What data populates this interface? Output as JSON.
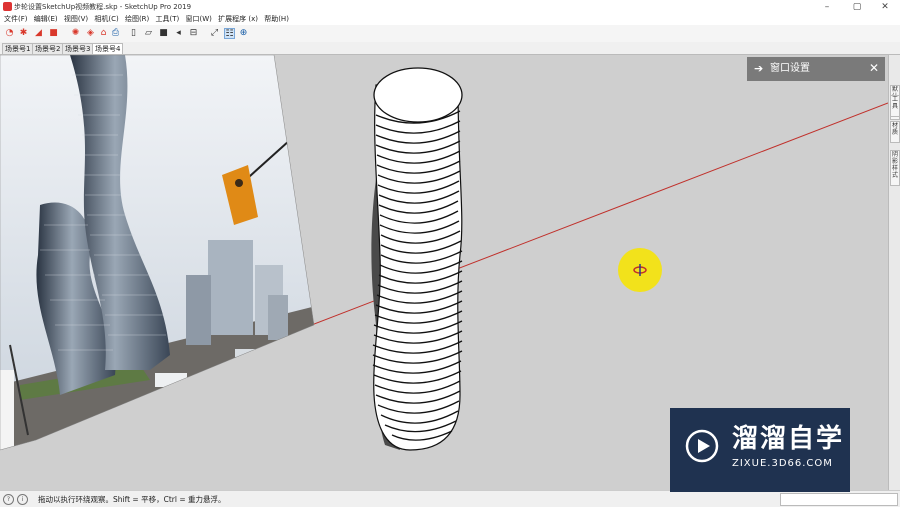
{
  "window": {
    "title": "步轮设置SketchUp视频教程.skp - SketchUp Pro 2019",
    "minimize_glyph": "–",
    "maximize_glyph": "▢",
    "close_glyph": "✕"
  },
  "menu": {
    "items": [
      "文件(F)",
      "编辑(E)",
      "视图(V)",
      "相机(C)",
      "绘图(R)",
      "工具(T)",
      "窗口(W)",
      "扩展程序 (x)",
      "帮助(H)"
    ]
  },
  "toolbar": {
    "icons": [
      "select-tool-icon",
      "paint-icon",
      "push-pull-icon",
      "camera-icon",
      "gear-icon",
      "component-icon",
      "warehouse-icon",
      "print-icon",
      "section-plane-icon",
      "section-icon",
      "section-fill-icon",
      "section-cut-icon",
      "scene-icon",
      "orbit-icon",
      "position-camera-icon",
      "look-around-icon"
    ]
  },
  "scenes": {
    "tabs": [
      "场景号1",
      "场景号2",
      "场景号3",
      "场景号4"
    ],
    "active_index": 3
  },
  "window_settings_panel": {
    "label": "窗口设置",
    "close_glyph": "✕"
  },
  "right_panel": {
    "tabs": [
      "默认面板",
      "工具",
      "材质",
      "阴影样式"
    ]
  },
  "statusbar": {
    "text": "拖动以执行环绕观察。Shift = 平移，Ctrl = 重力悬浮。"
  },
  "watermark": {
    "cn": "溜溜自学",
    "en": "ZIXUE.3D66.COM"
  },
  "colors": {
    "viewport": "#cfcfcf",
    "axis_red": "#c0302b",
    "cursor_yellow": "#f2e21b",
    "watermark_bg": "#1f3250"
  }
}
